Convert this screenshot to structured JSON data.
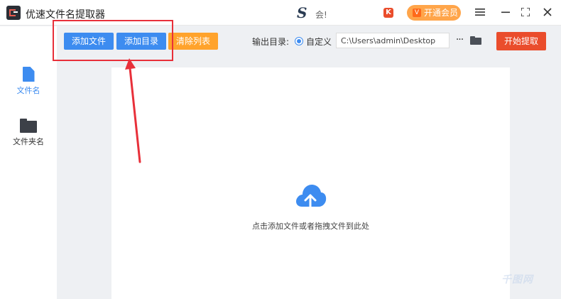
{
  "app": {
    "title": "优速文件名提取器",
    "center_logo_text": "会!"
  },
  "header": {
    "vip_label": "开通会员",
    "vip_badge": "V",
    "red_icon_glyph": "K"
  },
  "toolbar": {
    "add_file_label": "添加文件",
    "add_dir_label": "添加目录",
    "clear_list_label": "清除列表",
    "output_dir_label": "输出目录:",
    "custom_option_label": "自定义",
    "output_path_value": "C:\\Users\\admin\\Desktop",
    "more_label": "···",
    "start_label": "开始提取"
  },
  "sidebar": {
    "items": [
      {
        "label": "文件名",
        "icon": "file-icon",
        "active": true
      },
      {
        "label": "文件夹名",
        "icon": "folder-icon",
        "active": false
      }
    ]
  },
  "main": {
    "drop_hint": "点击添加文件或者拖拽文件到此处"
  },
  "watermark": {
    "text": "千图网"
  },
  "colors": {
    "primary_blue": "#3d8cf0",
    "orange": "#ffa32c",
    "start_red": "#ea4d2c",
    "annotation_red": "#e8303a",
    "vip_orange": "#ffa54a"
  }
}
